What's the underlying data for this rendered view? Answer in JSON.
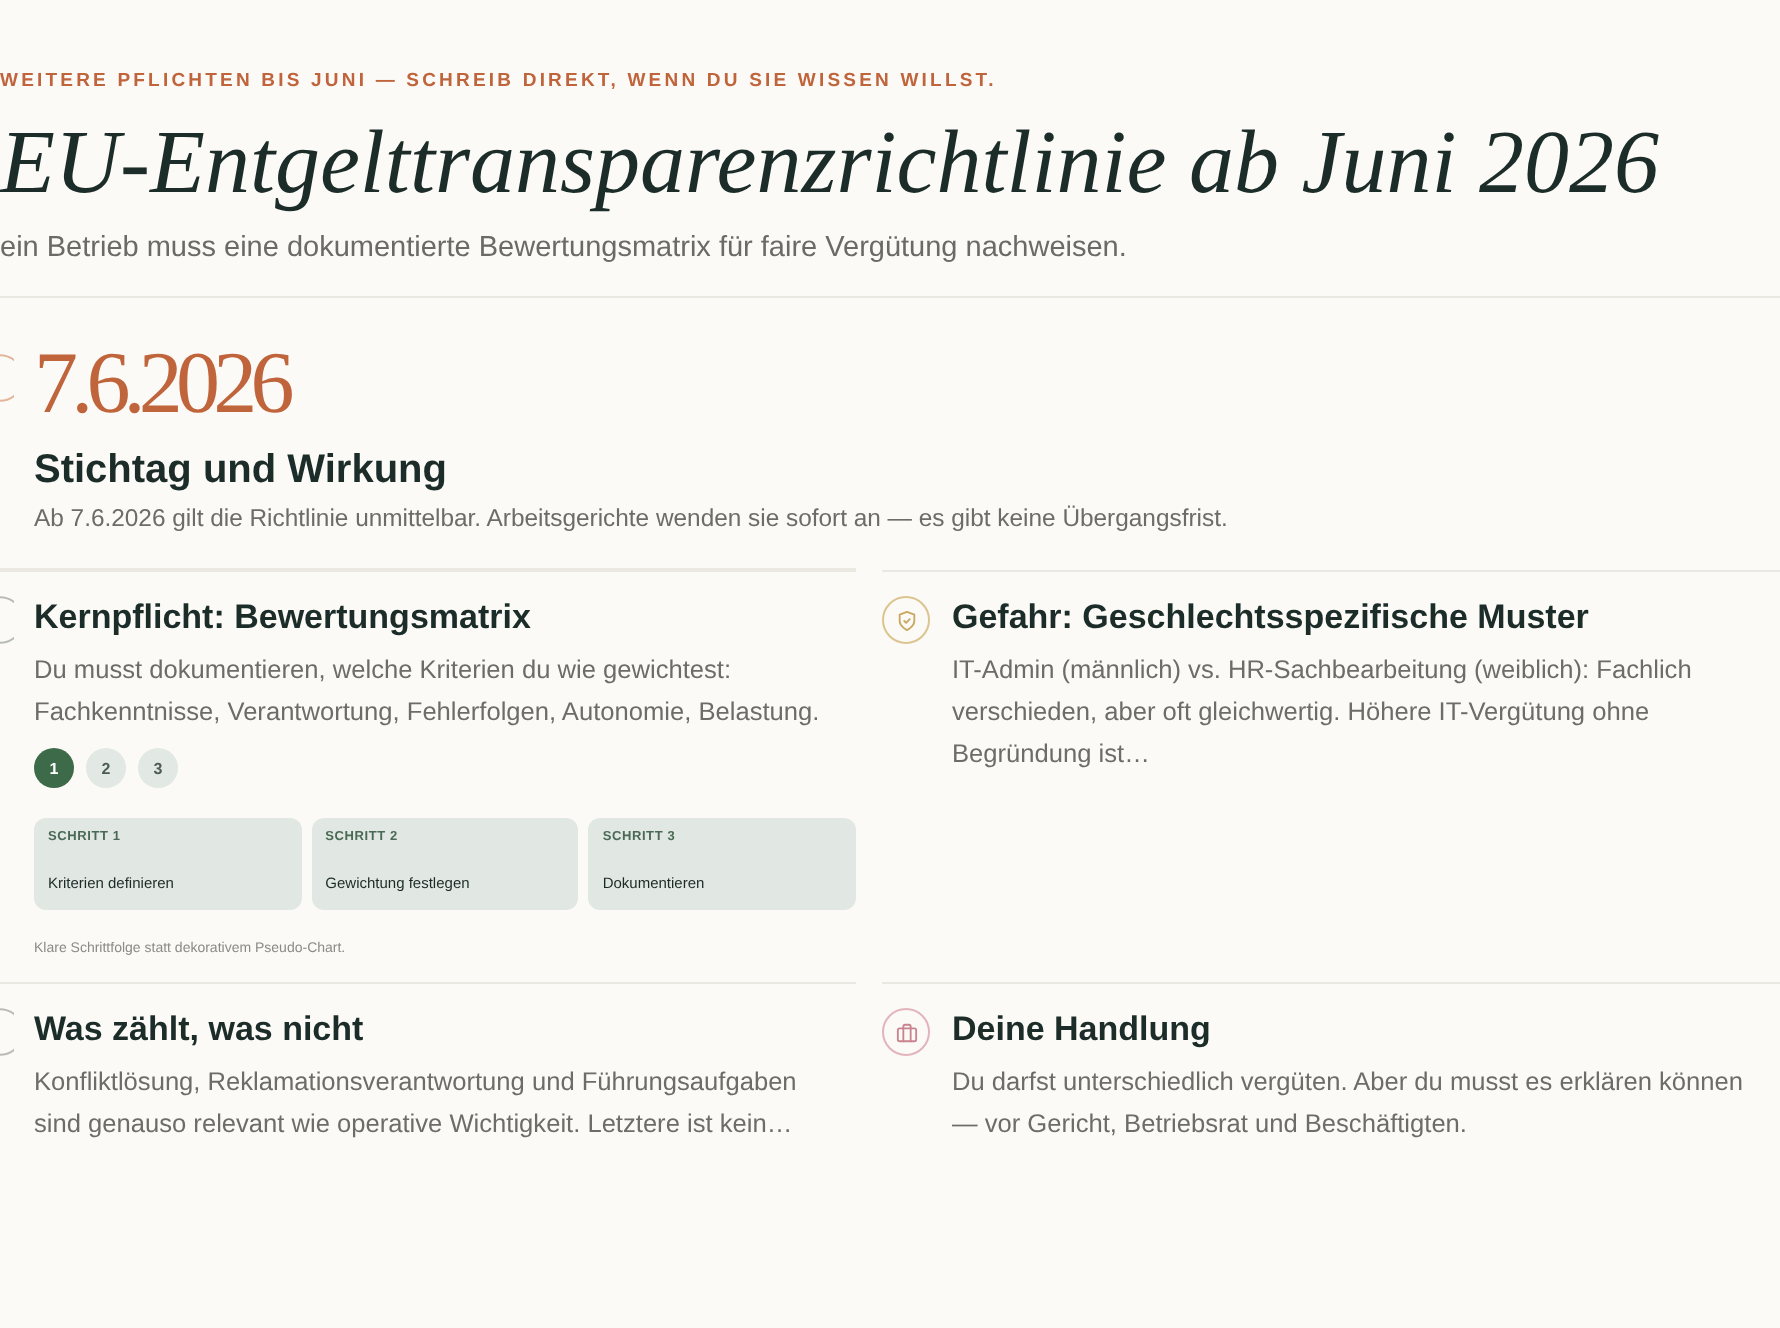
{
  "header": {
    "kicker": "WEITERE PFLICHTEN BIS JUNI — SCHREIB DIREKT, WENN DU SIE WISSEN WILLST.",
    "title": "EU-Entgelttransparenzrichtlinie ab Juni 2026",
    "lede": "ein Betrieb muss eine dokumentierte Bewertungsmatrix für faire Vergütung nachweisen."
  },
  "deadline": {
    "date": "7.6.2026",
    "heading": "Stichtag und Wirkung",
    "text": "Ab 7.6.2026 gilt die Richtlinie unmittelbar. Arbeitsgerichte wenden sie sofort an — es gibt keine Übergangsfrist."
  },
  "cards": [
    {
      "kind": "steps",
      "heading": "Kernpflicht: Bewertungsmatrix",
      "text": "Du musst dokumentieren, welche Kriterien du wie gewichtest: Fachkenntnisse, Verantwortung, Fehlerfolgen, Autonomie, Belastung.",
      "steps": [
        {
          "number": "1",
          "label": "SCHRITT 1",
          "title": "Kriterien definieren",
          "selected": true
        },
        {
          "number": "2",
          "label": "SCHRITT 2",
          "title": "Gewichtung festlegen",
          "selected": false
        },
        {
          "number": "3",
          "label": "SCHRITT 3",
          "title": "Dokumentieren",
          "selected": false
        }
      ],
      "caption": "Klare Schrittfolge statt dekorativem Pseudo-Chart."
    },
    {
      "kind": "text",
      "heading": "Gefahr: Geschlechtsspezifische Muster",
      "text": "IT-Admin (männlich) vs. HR-Sachbearbeitung (weiblich): Fachlich verschieden, aber oft gleichwertig. Höhere IT-Vergütung ohne Begründung ist…"
    },
    {
      "kind": "text",
      "heading": "Was zählt, was nicht",
      "text": "Konfliktlösung, Reklamationsverantwortung und Führungsaufgaben sind genauso relevant wie operative Wichtigkeit. Letztere ist kein…"
    },
    {
      "kind": "text",
      "heading": "Deine Handlung",
      "text": "Du darfst unterschiedlich vergüten. Aber du musst es erklären können — vor Gericht, Betriebsrat und Beschäftigten."
    }
  ]
}
